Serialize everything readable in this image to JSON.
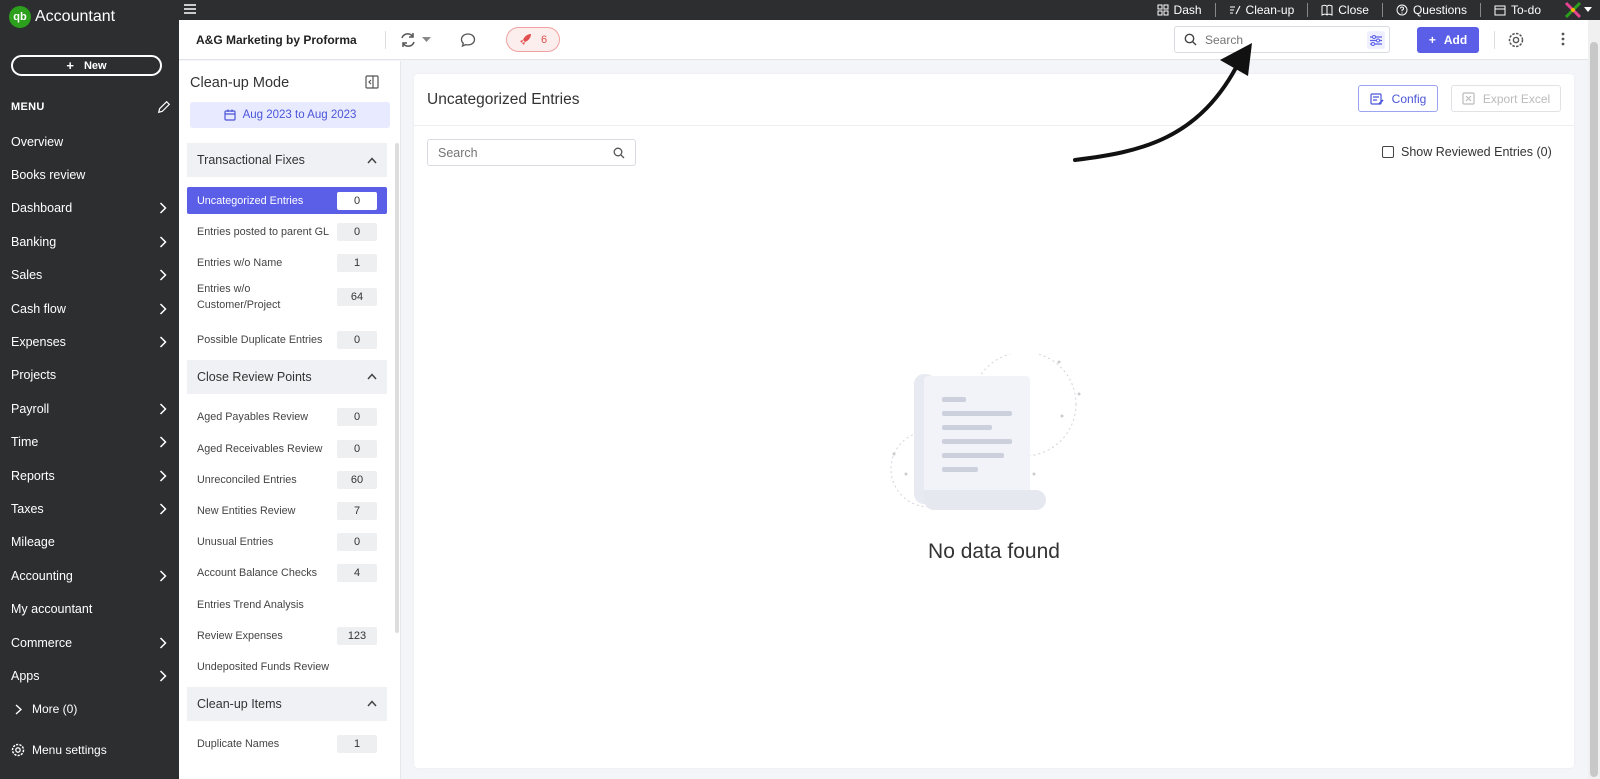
{
  "app": {
    "brand": "Accountant",
    "logo": "qb"
  },
  "leftnav": {
    "new_label": "New",
    "menu_label": "MENU",
    "items": [
      {
        "label": "Overview",
        "chevron": false
      },
      {
        "label": "Books review",
        "chevron": false
      },
      {
        "label": "Dashboard",
        "chevron": true
      },
      {
        "label": "Banking",
        "chevron": true
      },
      {
        "label": "Sales",
        "chevron": true
      },
      {
        "label": "Cash flow",
        "chevron": true
      },
      {
        "label": "Expenses",
        "chevron": true
      },
      {
        "label": "Projects",
        "chevron": false
      },
      {
        "label": "Payroll",
        "chevron": true
      },
      {
        "label": "Time",
        "chevron": true
      },
      {
        "label": "Reports",
        "chevron": true
      },
      {
        "label": "Taxes",
        "chevron": true
      },
      {
        "label": "Mileage",
        "chevron": false
      },
      {
        "label": "Accounting",
        "chevron": true
      },
      {
        "label": "My accountant",
        "chevron": false
      },
      {
        "label": "Commerce",
        "chevron": true
      },
      {
        "label": "Apps",
        "chevron": true
      }
    ],
    "more_label": "More (0)",
    "settings_label": "Menu settings"
  },
  "topbar": {
    "links": [
      {
        "label": "Dash",
        "icon": "grid-icon"
      },
      {
        "label": "Clean-up",
        "icon": "broom-icon"
      },
      {
        "label": "Close",
        "icon": "book-icon"
      },
      {
        "label": "Questions",
        "icon": "question-icon"
      },
      {
        "label": "To-do",
        "icon": "calendar-icon"
      }
    ]
  },
  "header": {
    "company": "A&G Marketing by Proforma",
    "alert_count": "6",
    "search_placeholder": "Search",
    "add_label": "Add"
  },
  "cleanup": {
    "title": "Clean-up Mode",
    "date_range": "Aug 2023 to Aug 2023",
    "sections": [
      {
        "title": "Transactional Fixes",
        "items": [
          {
            "label": "Uncategorized Entries",
            "count": "0",
            "active": true
          },
          {
            "label": "Entries posted to parent GL",
            "count": "0"
          },
          {
            "label": "Entries w/o Name",
            "count": "1"
          },
          {
            "label": "Entries w/o Customer/Project",
            "count": "64"
          },
          {
            "label": "Possible Duplicate Entries",
            "count": "0"
          }
        ]
      },
      {
        "title": "Close Review Points",
        "items": [
          {
            "label": "Aged Payables Review",
            "count": "0"
          },
          {
            "label": "Aged Receivables Review",
            "count": "0"
          },
          {
            "label": "Unreconciled Entries",
            "count": "60"
          },
          {
            "label": "New Entities Review",
            "count": "7"
          },
          {
            "label": "Unusual Entries",
            "count": "0"
          },
          {
            "label": "Account Balance Checks",
            "count": "4"
          },
          {
            "label": "Entries Trend Analysis",
            "count": null
          },
          {
            "label": "Review Expenses",
            "count": "123"
          },
          {
            "label": "Undeposited Funds Review",
            "count": null
          }
        ]
      },
      {
        "title": "Clean-up Items",
        "items": [
          {
            "label": "Duplicate Names",
            "count": "1"
          }
        ]
      }
    ]
  },
  "main": {
    "title": "Uncategorized Entries",
    "config_label": "Config",
    "export_label": "Export Excel",
    "search_placeholder": "Search",
    "show_reviewed_label": "Show Reviewed Entries (0)",
    "empty_text": "No data found"
  },
  "colors": {
    "accent": "#5b5fe8",
    "nav_bg": "#2d2e30",
    "alert": "#e05050"
  }
}
